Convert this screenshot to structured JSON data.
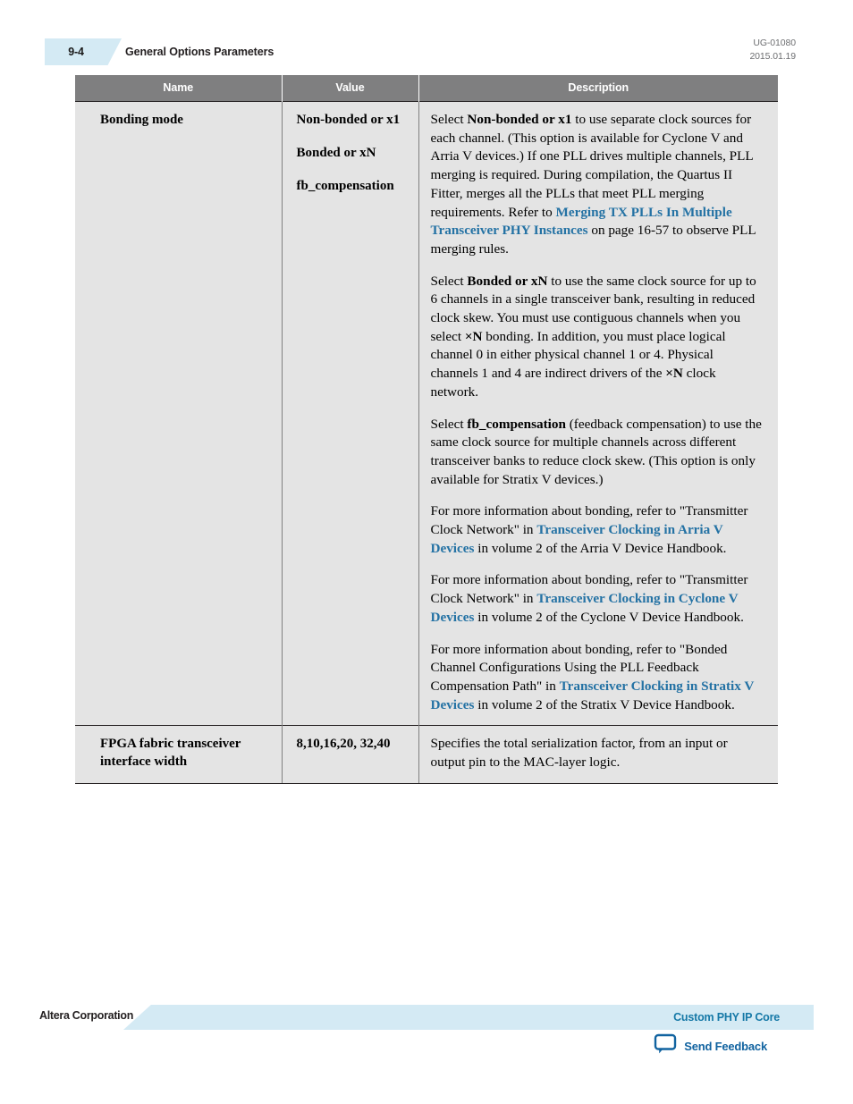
{
  "header": {
    "page_number": "9-4",
    "title": "General Options Parameters",
    "doc_id": "UG-01080",
    "doc_date": "2015.01.19"
  },
  "table": {
    "columns": [
      "Name",
      "Value",
      "Description"
    ],
    "rows": [
      {
        "name": "Bonding mode",
        "values": [
          "Non-bonded or x1",
          "Bonded or xN",
          "fb_compensation"
        ],
        "paragraphs": [
          {
            "id": "p-nonbonded",
            "runs": [
              {
                "t": "Select ",
                "s": "normal"
              },
              {
                "t": "Non-bonded or x1",
                "s": "bold"
              },
              {
                "t": " to use separate clock sources for each channel. (This option is available for Cyclone V and Arria V devices.) If one PLL drives multiple channels, PLL merging is required. During compilation, the Quartus II Fitter, merges all the PLLs that meet PLL merging requirements. Refer to ",
                "s": "normal"
              },
              {
                "t": "Merging TX PLLs In Multiple Transceiver PHY Instances",
                "s": "link"
              },
              {
                "t": " on page 16-57 to observe PLL merging rules.",
                "s": "normal"
              }
            ]
          },
          {
            "id": "p-bonded",
            "runs": [
              {
                "t": "Select ",
                "s": "normal"
              },
              {
                "t": "Bonded or xN",
                "s": "bold"
              },
              {
                "t": " to use the same clock source for up to 6 channels in a single transceiver bank, resulting in reduced clock skew. You must use contiguous channels when you select ",
                "s": "normal"
              },
              {
                "t": "×N",
                "s": "bold"
              },
              {
                "t": " bonding. In addition, you must place logical channel 0 in either physical channel 1 or 4. Physical channels 1 and 4 are indirect drivers of the ",
                "s": "normal"
              },
              {
                "t": "×N",
                "s": "bold"
              },
              {
                "t": " clock network.",
                "s": "normal"
              }
            ]
          },
          {
            "id": "p-fbcomp",
            "runs": [
              {
                "t": "Select ",
                "s": "normal"
              },
              {
                "t": "fb_compensation",
                "s": "bold"
              },
              {
                "t": " (feedback compensation) to use the same clock source for multiple channels across different transceiver banks to reduce clock skew. (This option is only available for Stratix V devices.)",
                "s": "normal"
              }
            ]
          },
          {
            "id": "p-arria",
            "runs": [
              {
                "t": "For more information about bonding, refer to \"Transmitter Clock Network\" in ",
                "s": "normal"
              },
              {
                "t": "Transceiver Clocking in Arria V Devices",
                "s": "link"
              },
              {
                "t": " in volume 2 of the Arria V Device Handbook.",
                "s": "normal"
              }
            ]
          },
          {
            "id": "p-cyclone",
            "runs": [
              {
                "t": "For more information about bonding, refer to \"Transmitter Clock Network\" in ",
                "s": "normal"
              },
              {
                "t": "Transceiver Clocking in Cyclone V Devices",
                "s": "link"
              },
              {
                "t": " in volume 2 of the Cyclone V Device Handbook.",
                "s": "normal"
              }
            ]
          },
          {
            "id": "p-stratix",
            "runs": [
              {
                "t": "For more information about bonding, refer to \"Bonded Channel Configurations Using the PLL Feedback Compensation Path\" in ",
                "s": "normal"
              },
              {
                "t": "Transceiver Clocking in Stratix V Devices",
                "s": "link"
              },
              {
                "t": " in volume 2 of the Stratix V Device Handbook.",
                "s": "normal"
              }
            ]
          }
        ]
      },
      {
        "name": "FPGA fabric transceiver interface width",
        "values": [
          "8,10,16,20, 32,40"
        ],
        "paragraphs": [
          {
            "id": "p-width",
            "runs": [
              {
                "t": "Specifies the total serialization factor, from an input or output pin to the MAC-layer logic.",
                "s": "normal"
              }
            ]
          }
        ]
      }
    ]
  },
  "footer": {
    "company": "Altera Corporation",
    "doc_link": "Custom PHY IP Core",
    "feedback_label": "Send Feedback",
    "feedback_icon": "speech-bubble-icon"
  },
  "colors": {
    "tab_blue": "#d4eaf4",
    "header_gray": "#7f7f80",
    "row_gray": "#e4e4e4",
    "link_blue": "#2472a4",
    "footer_link_blue": "#1679a7",
    "feedback_blue": "#1163a0"
  }
}
